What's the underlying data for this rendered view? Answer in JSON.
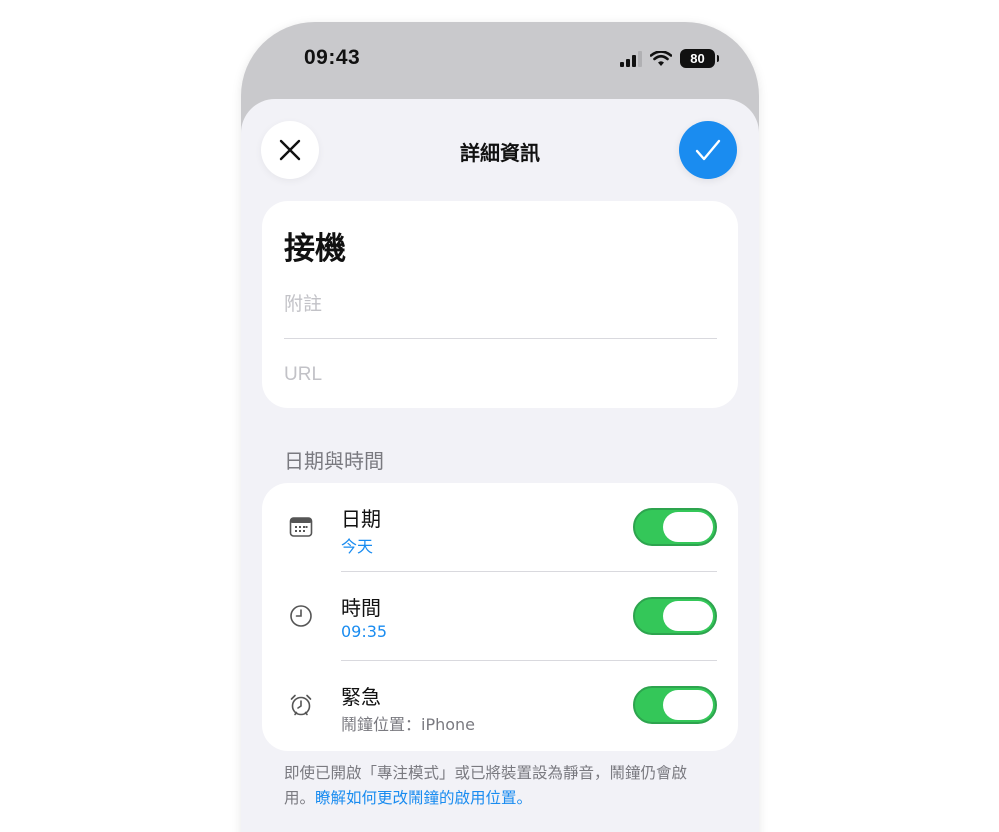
{
  "status_bar": {
    "time": "09:43",
    "battery_level": "80",
    "icons": [
      "cellular-signal-icon",
      "wifi-icon",
      "battery-icon"
    ]
  },
  "nav": {
    "title": "詳細資訊",
    "close_icon": "close-icon",
    "done_icon": "checkmark-icon"
  },
  "reminder": {
    "title": "接機",
    "notes_placeholder": "附註",
    "url_placeholder": "URL"
  },
  "date_time_section": {
    "header": "日期與時間",
    "rows": [
      {
        "icon": "calendar-icon",
        "label": "日期",
        "sub": "今天",
        "enabled": true
      },
      {
        "icon": "clock-icon",
        "label": "時間",
        "sub": "09:35",
        "enabled": true
      },
      {
        "icon": "alarm-clock-icon",
        "label": "緊急",
        "sub": "鬧鐘位置：iPhone",
        "enabled": true
      }
    ]
  },
  "footnote": {
    "text": "即使已開啟「專注模式」或已將裝置設為靜音，鬧鐘仍會啟用。",
    "link": "瞭解如何更改鬧鐘的啟用位置。"
  },
  "colors": {
    "accent": "#1a8cf0",
    "toggle_on": "#34c759",
    "background": "#f2f2f7",
    "secondary_text": "#7a7a80"
  }
}
